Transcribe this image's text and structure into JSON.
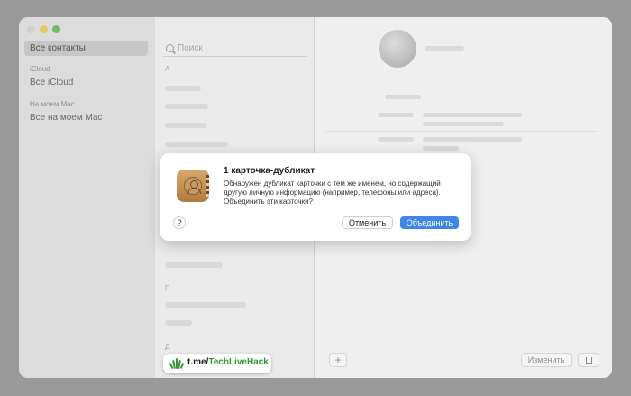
{
  "sidebar": {
    "all_contacts": "Все контакты",
    "icloud_header": "iCloud",
    "all_icloud": "Все iCloud",
    "mac_header": "На моем Mac",
    "all_mac": "Все на моем Mac"
  },
  "list": {
    "search_placeholder": "Поиск",
    "letters": [
      "А",
      "Г",
      "Д"
    ]
  },
  "detail": {
    "edit_label": "Изменить",
    "add_label": "+"
  },
  "dialog": {
    "title": "1 карточка-дубликат",
    "message": "Обнаружен дубликат карточки с тем же именем, но содержащий другую личную информацию (например, телефоны или адреса). Объединить эти карточки?",
    "help_label": "?",
    "cancel_label": "Отменить",
    "merge_label": "Объединить"
  },
  "watermark": {
    "prefix": "t.me/",
    "brand": "TechLiveHack"
  },
  "colors": {
    "accent": "#3d86f0",
    "brand_green": "#2f9a2f"
  }
}
